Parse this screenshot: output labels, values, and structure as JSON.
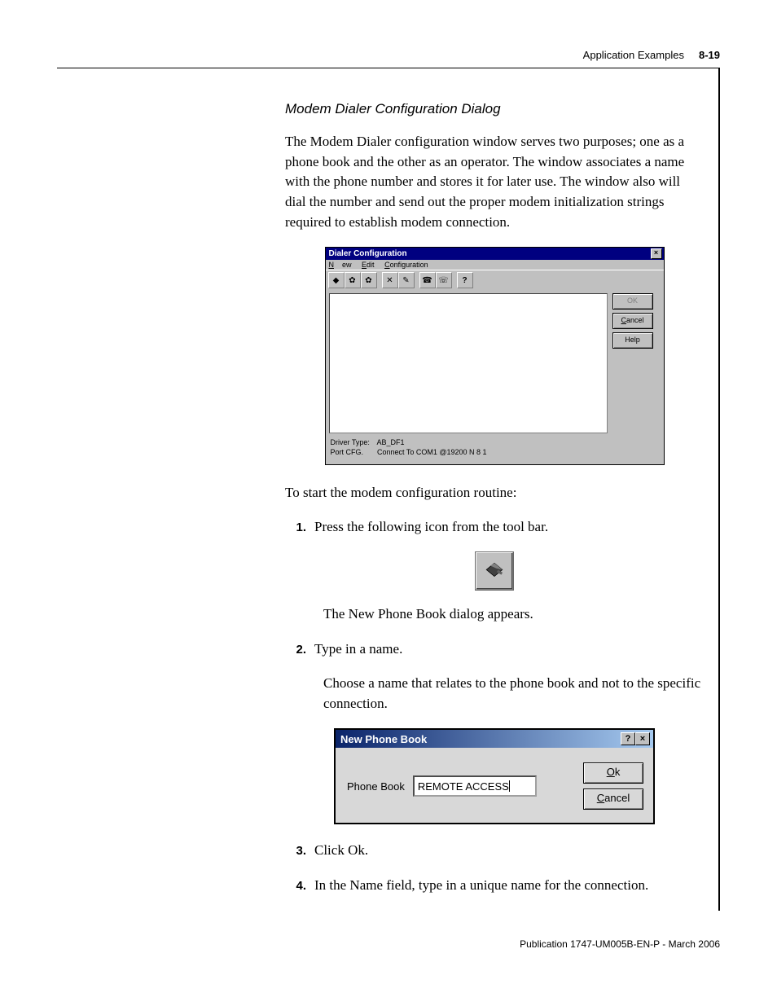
{
  "header": {
    "section": "Application Examples",
    "pagenum": "8-19"
  },
  "subhead": "Modem Dialer Configuration Dialog",
  "intro": "The Modem Dialer configuration window serves two purposes; one as a phone book and the other as an operator. The window associates a name with the phone number and stores it for later use. The window also will dial the number and send out the proper modem initialization strings required to establish modem connection.",
  "dialer_dialog": {
    "title": "Dialer Configuration",
    "menus": {
      "m1": "New",
      "m2": "Edit",
      "m3": "Configuration"
    },
    "buttons": {
      "ok": "OK",
      "cancel": "Cancel",
      "help": "Help"
    },
    "status": {
      "driver_label": "Driver Type:",
      "driver_value": "AB_DF1",
      "port_label": "Port CFG.",
      "port_value": "Connect To  COM1 @19200 N 8 1"
    }
  },
  "lead": "To start the modem configuration routine:",
  "steps": {
    "s1": "Press the following icon from the tool bar.",
    "s1_after": "The New Phone Book dialog appears.",
    "s2": "Type in a name.",
    "s2_after": "Choose a name that relates to the phone book and not to the specific connection.",
    "s3": "Click Ok.",
    "s4": "In the Name field, type in a unique name for the connection."
  },
  "phonebook_dialog": {
    "title": "New Phone Book",
    "label": "Phone Book",
    "input_value": "REMOTE ACCESS",
    "ok": "Ok",
    "cancel": "Cancel"
  },
  "footer": "Publication 1747-UM005B-EN-P - March 2006"
}
